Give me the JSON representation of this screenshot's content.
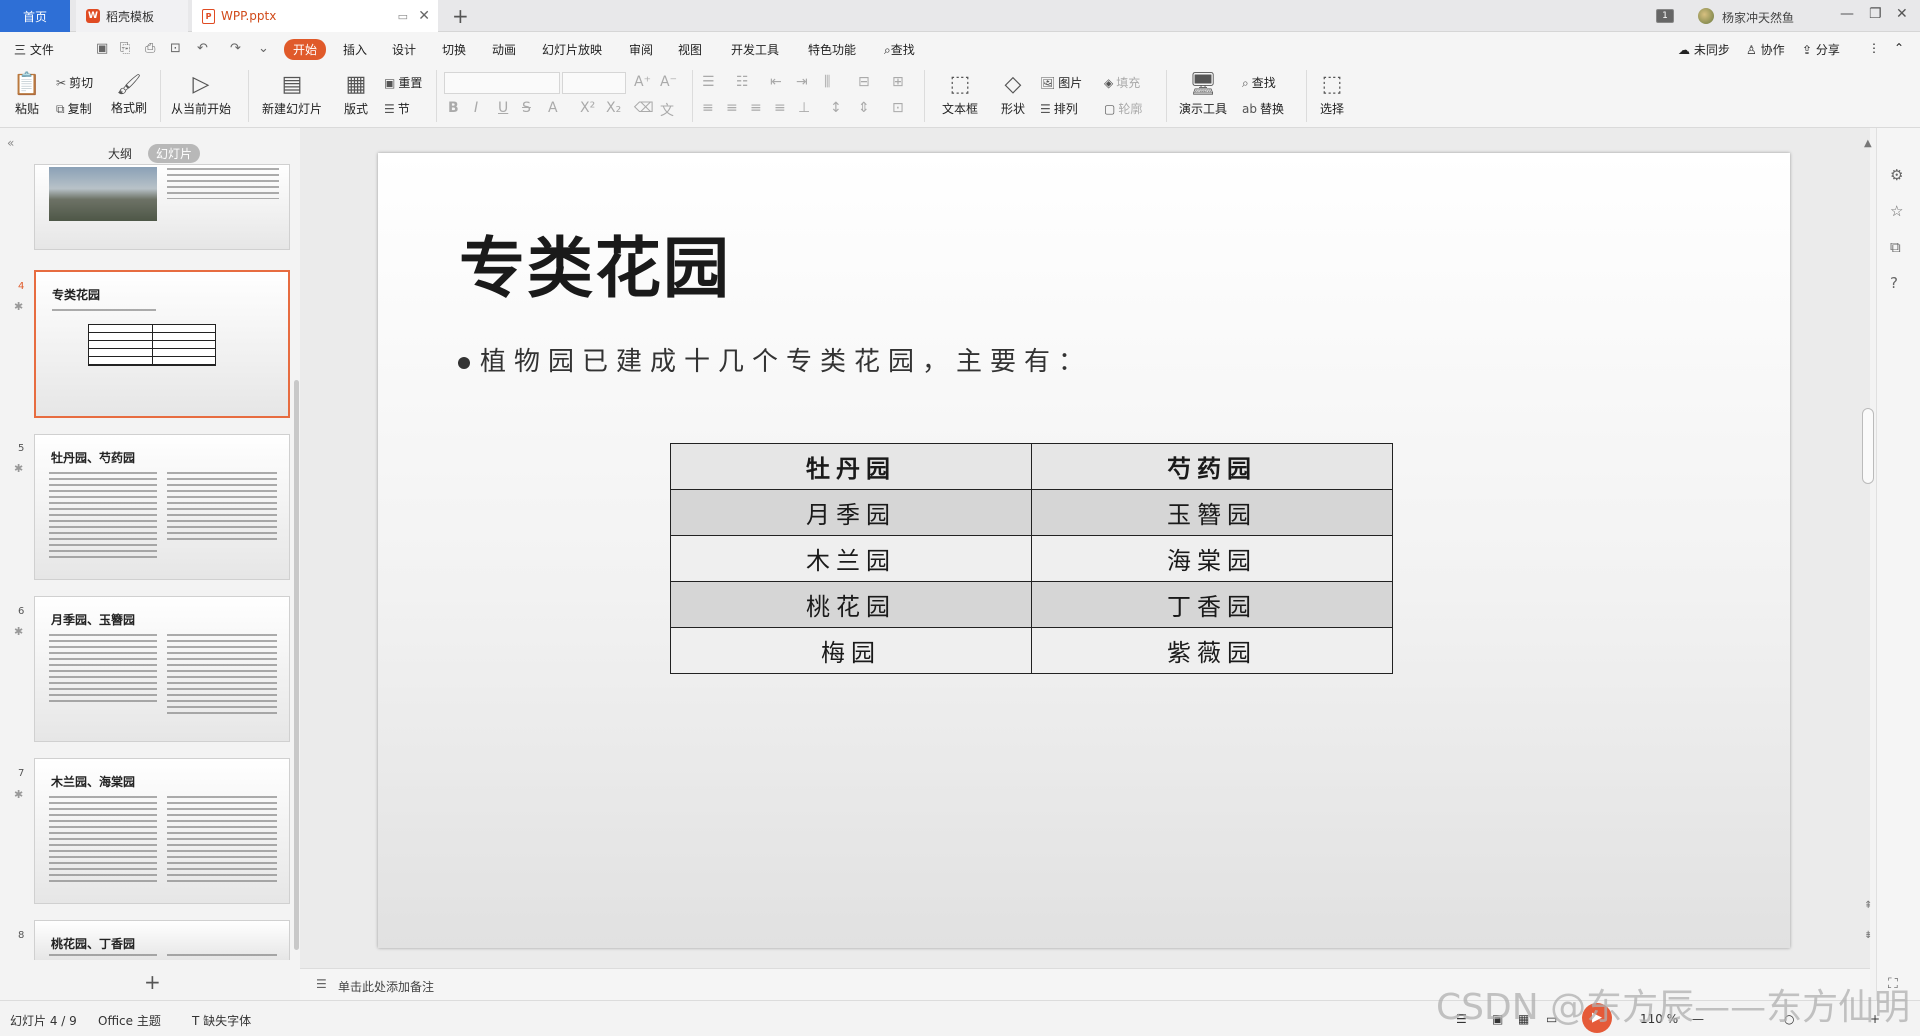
{
  "tabbar": {
    "home": "首页",
    "template_tab": "稻壳模板",
    "file_tab": "WPP.pptx",
    "new_tab": "+",
    "badge": "1",
    "user": "杨家冲天然鱼",
    "win_min": "—",
    "win_max": "❐",
    "win_close": "✕"
  },
  "menu": {
    "file": "三 文件",
    "items": [
      "开始",
      "插入",
      "设计",
      "切换",
      "动画",
      "幻灯片放映",
      "审阅",
      "视图",
      "开发工具",
      "特色功能"
    ],
    "search": "查找",
    "sync": "未同步",
    "collab": "协作",
    "share": "分享"
  },
  "ribbon": {
    "paste": "粘贴",
    "cut": "剪切",
    "copy": "复制",
    "format_painter": "格式刷",
    "from_current": "从当前开始",
    "new_slide": "新建幻灯片",
    "layout": "版式",
    "reset": "重置",
    "section": "节",
    "textbox": "文本框",
    "shape": "形状",
    "picture": "图片",
    "fill": "填充",
    "arrange": "排列",
    "outline": "轮廓",
    "presenter_tools": "演示工具",
    "find": "查找",
    "replace": "替换",
    "select": "选择"
  },
  "panel": {
    "outline_tab": "大纲",
    "slides_tab": "幻灯片",
    "add": "+"
  },
  "thumbnails": [
    {
      "num": "4",
      "title": "专类花园"
    },
    {
      "num": "5",
      "title": "牡丹园、芍药园"
    },
    {
      "num": "6",
      "title": "月季园、玉簪园"
    },
    {
      "num": "7",
      "title": "木兰园、海棠园"
    },
    {
      "num": "8",
      "title": "桃花园、丁香园"
    }
  ],
  "slide": {
    "title": "专类花园",
    "bullet": "植物园已建成十几个专类花园，主要有：",
    "table": [
      [
        "牡丹园",
        "芍药园"
      ],
      [
        "月季园",
        "玉簪园"
      ],
      [
        "木兰园",
        "海棠园"
      ],
      [
        "桃花园",
        "丁香园"
      ],
      [
        "梅园",
        "紫薇园"
      ]
    ]
  },
  "notes": {
    "placeholder": "单击此处添加备注"
  },
  "status": {
    "slide_info": "幻灯片 4 / 9",
    "theme": "Office 主题",
    "missing_font": "缺失字体",
    "zoom": "110 %"
  },
  "watermark": "CSDN @东方辰——东方仙明"
}
